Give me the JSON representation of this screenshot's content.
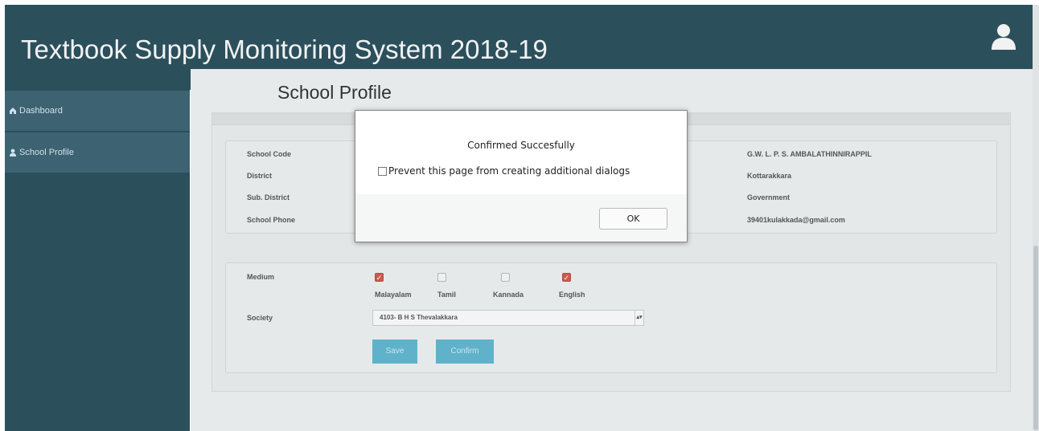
{
  "header": {
    "title": "Textbook Supply Monitoring System 2018-19"
  },
  "sidebar": {
    "items": [
      {
        "label": "Dashboard",
        "icon": "dashboard-icon"
      },
      {
        "label": "School Profile",
        "icon": "user-icon"
      }
    ]
  },
  "page": {
    "title": "School Profile"
  },
  "profile": {
    "labels": [
      "School Code",
      "District",
      "Sub. District",
      "School Phone"
    ],
    "values": [
      "G.W. L. P. S. AMBALATHINNIRAPPIL",
      "Kottarakkara",
      "Government",
      "39401kulakkada@gmail.com"
    ]
  },
  "medium": {
    "label": "Medium",
    "options": [
      {
        "label": "Malayalam",
        "checked": true
      },
      {
        "label": "Tamil",
        "checked": false
      },
      {
        "label": "Kannada",
        "checked": false
      },
      {
        "label": "English",
        "checked": true
      }
    ]
  },
  "society": {
    "label": "Society",
    "selected": "4103- B H S Thevalakkara"
  },
  "buttons": {
    "save": "Save",
    "confirm": "Confirm"
  },
  "dialog": {
    "message": "Confirmed Succesfully",
    "checkbox_label": "Prevent this page from creating additional dialogs",
    "ok": "OK"
  },
  "colors": {
    "header": "#2c4f5c",
    "sidebar_item": "#3d6272",
    "button": "#5fb2ca",
    "checked": "#c95a4c"
  }
}
